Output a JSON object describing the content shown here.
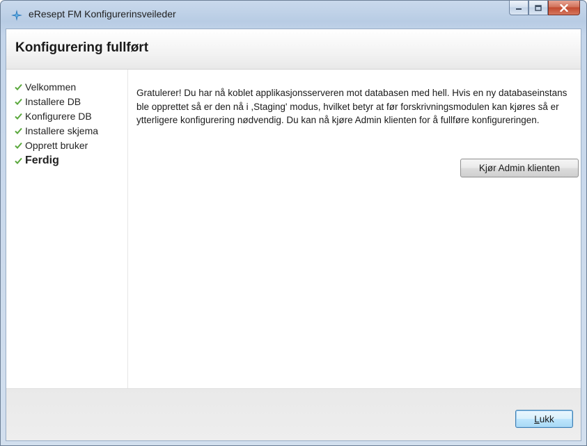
{
  "window": {
    "title": "eResept FM Konfigurerinsveileder",
    "icon": "eresept-app-icon",
    "controls": [
      "minimize-icon",
      "maximize-icon",
      "close-icon"
    ]
  },
  "header": {
    "title": "Konfigurering fullført"
  },
  "steps": [
    {
      "label": "Velkommen",
      "icon": "check-icon",
      "current": false
    },
    {
      "label": "Installere DB",
      "icon": "check-icon",
      "current": false
    },
    {
      "label": "Konfigurere DB",
      "icon": "check-icon",
      "current": false
    },
    {
      "label": "Installere skjema",
      "icon": "check-icon",
      "current": false
    },
    {
      "label": "Opprett bruker",
      "icon": "check-icon",
      "current": false
    },
    {
      "label": "Ferdig",
      "icon": "check-icon",
      "current": true
    }
  ],
  "content": {
    "message": "Gratulerer!  Du har nå koblet applikasjonsserveren mot databasen med hell.  Hvis en ny databaseinstans ble opprettet så er den nå i ,Staging' modus, hvilket betyr at før forskrivningsmodulen kan kjøres så er ytterligere konfigurering nødvendig.  Du kan nå kjøre Admin klienten for å fullføre konfigureringen.",
    "admin_button_label": "Kjør Admin klienten"
  },
  "footer": {
    "close_button": {
      "mnemonic": "L",
      "rest": "ukk"
    }
  },
  "colors": {
    "check": "#5aa83c",
    "close_accent": "#c24a2f",
    "primary_button_border": "#3c7fb1"
  }
}
